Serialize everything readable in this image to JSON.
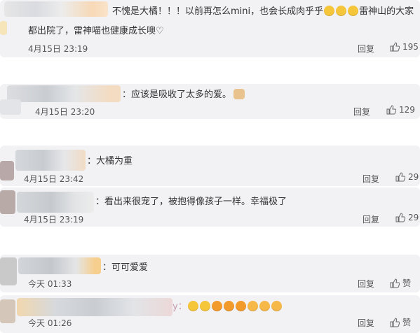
{
  "comments": [
    {
      "line1": "不愧是大橘！！！以前再怎么mini，也会长成肉乎乎",
      "line1_tail": "雷神山的大家",
      "line2": "都出院了，雷神喵也健康成长噢",
      "heart": "♡",
      "time": "4月15日 23:19",
      "reply": "回复",
      "likes": "195"
    },
    {
      "text": "：应该是吸收了太多的爱。",
      "time": "4月15日 23:20",
      "reply": "回复",
      "likes": "129"
    },
    {
      "text": "：大橘为重",
      "time": "4月15日 23:42",
      "reply": "回复",
      "likes": "29"
    },
    {
      "text": "：看出来很宠了，被抱得像孩子一样。幸福极了",
      "time": "4月15日 23:19",
      "reply": "回复",
      "likes": "29"
    },
    {
      "text": "：可可爱爱",
      "time": "今天 01:33",
      "reply": "回复",
      "likes": "赞"
    },
    {
      "text_prefix": "y：",
      "time": "今天 01:26",
      "reply": "回复",
      "likes": "赞"
    }
  ],
  "icons": {
    "thumb": "thumbs-up-icon",
    "emoji": "face-emoji-icon",
    "cat": "cat-emoji-icon"
  },
  "colors": {
    "card_bg": "#f2f2f5",
    "text": "#333333"
  }
}
